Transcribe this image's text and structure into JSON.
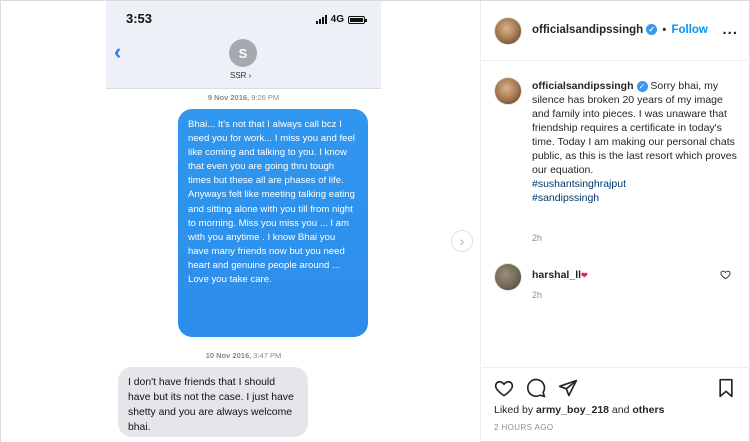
{
  "phone": {
    "time": "3:53",
    "network": "4G",
    "back": "‹",
    "contact_initial": "S",
    "contact_name": "SSR ›",
    "stamp1_date": "9 Nov 2016,",
    "stamp1_time": "9:26 PM",
    "message_blue": "Bhai... It's not that I always call bcz I need you for work... I miss you and feel like coming and talking to you. I know that even you are going thru tough times but these all are phases of life. Anyways felt like meeting talking eating and sitting alone with you till from night to morning. Miss you miss you ... I am with you anytime . I know Bhai you have many friends now but you need heart and genuine people around ... Love you take care.",
    "stamp2_date": "10 Nov 2016,",
    "stamp2_time": "3:47 PM",
    "message_grey": "I don't have friends that I should have but its not the case. I just have shetty and you are always welcome bhai."
  },
  "header": {
    "username": "officialsandipssingh",
    "verified_mark": "✓",
    "dot": "•",
    "follow_label": "Follow",
    "more_label": "..."
  },
  "caption": {
    "username": "officialsandipssingh",
    "text": " Sorry bhai, my silence has broken 20 years of my image and family into pieces. I was unaware that friendship requires a certificate in today's time. Today I am making our personal chats public, as this is the last resort which proves our equation.",
    "hashtag1": "#sushantsinghrajput",
    "hashtag2": "#sandipssingh",
    "time": "2h"
  },
  "comment": {
    "username": "harshal_ll",
    "emoji": "❤",
    "time": "2h"
  },
  "footer": {
    "liked_prefix": "Liked by ",
    "liked_user": "army_boy_218",
    "liked_mid": " and ",
    "liked_others": "others",
    "ago": "2 HOURS AGO"
  },
  "icons": {
    "like": "heart-icon",
    "comment": "comment-icon",
    "share": "share-icon",
    "save": "bookmark-icon",
    "next": "chevron-right-icon"
  }
}
